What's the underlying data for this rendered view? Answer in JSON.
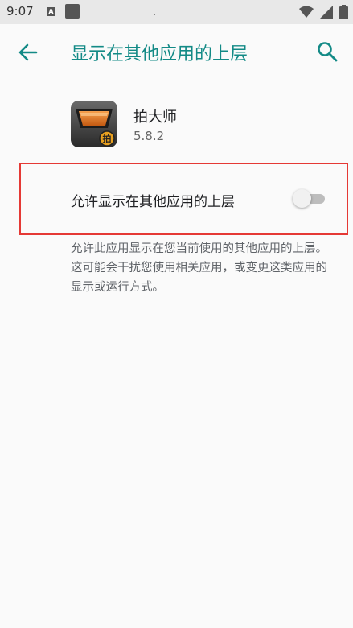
{
  "status_bar": {
    "time": "9:07",
    "notification_letter": "A"
  },
  "app_bar": {
    "title": "显示在其他应用的上层",
    "back_icon": "arrow-left-icon",
    "search_icon": "search-icon"
  },
  "app_info": {
    "name": "拍大师",
    "version": "5.8.2",
    "icon_badge": "拍"
  },
  "setting": {
    "label": "允许显示在其他应用的上层",
    "enabled": false
  },
  "description": "允许此应用显示在您当前使用的其他应用的上层。这可能会干扰您使用相关应用，或变更这类应用的显示或运行方式。",
  "colors": {
    "accent": "#138a86",
    "highlight": "#e53935",
    "background": "#fafafa"
  }
}
